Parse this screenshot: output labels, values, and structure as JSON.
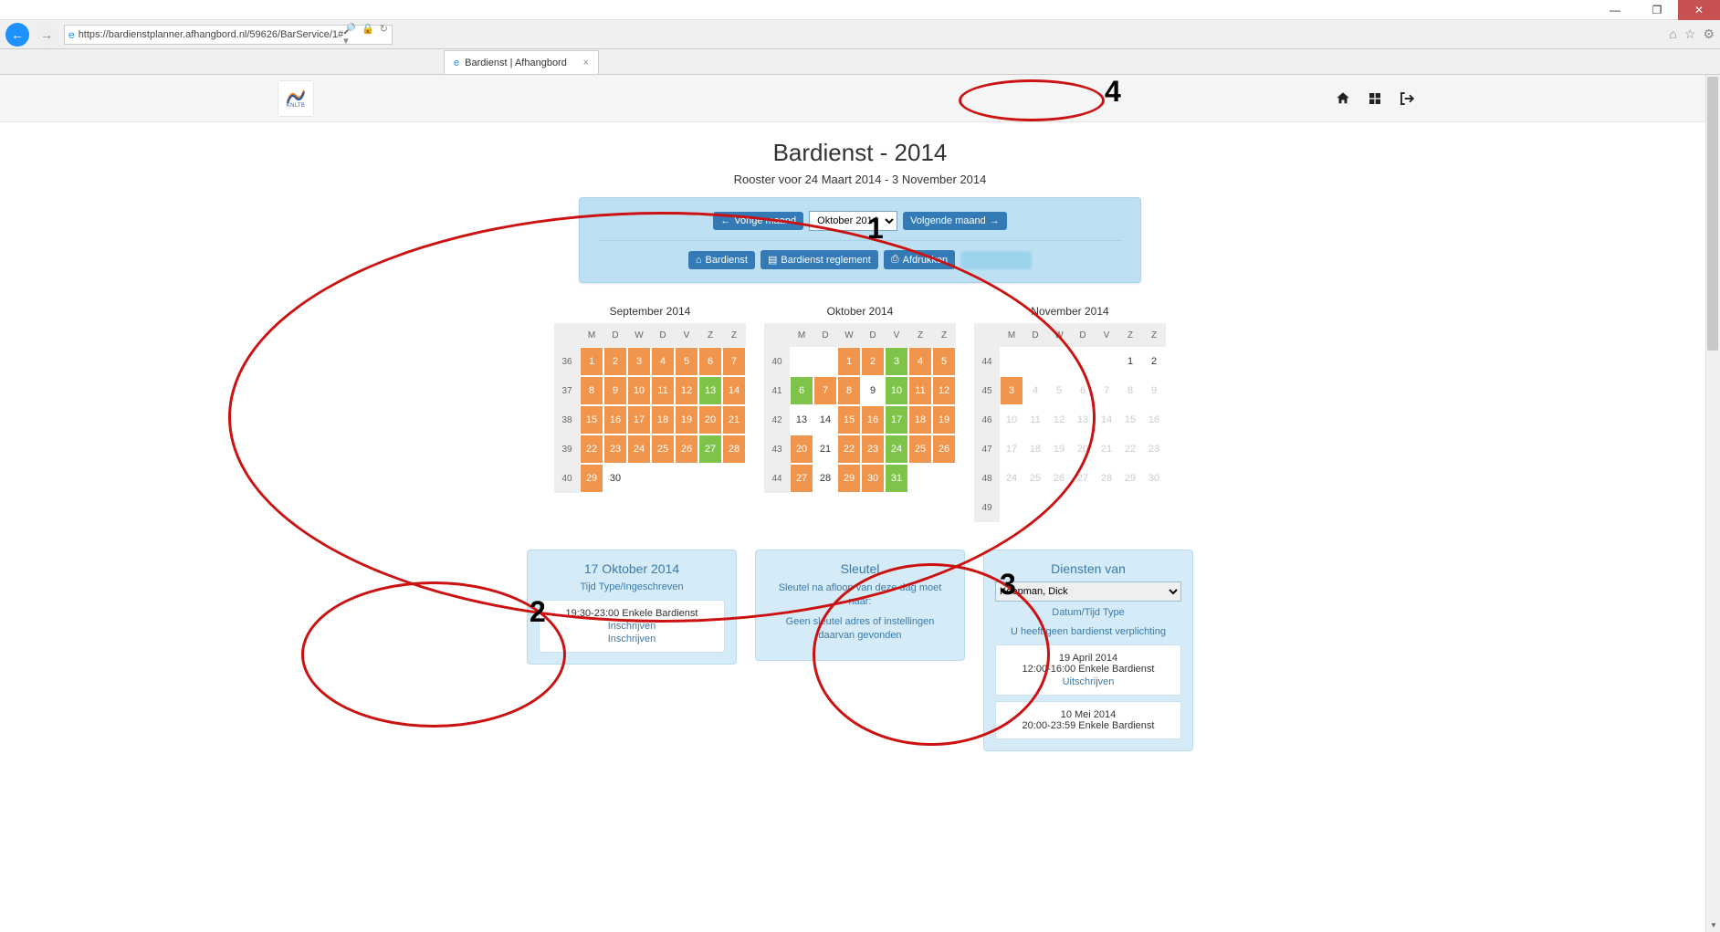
{
  "browser": {
    "url": "https://bardienstplanner.afhangbord.nl/59626/BarService/1#",
    "tab_title": "Bardienst | Afhangbord"
  },
  "header": {
    "logo_text": "KNLTB"
  },
  "page": {
    "title": "Bardienst - 2014",
    "subtitle": "Rooster voor 24 Maart 2014 - 3 November 2014"
  },
  "toolbar": {
    "prev": "Vorige maand",
    "next": "Volgende maand",
    "month_select": "Oktober 2014",
    "bardienst": "Bardienst",
    "reglement": "Bardienst reglement",
    "afdrukken": "Afdrukken"
  },
  "calendars": [
    {
      "title": "September 2014",
      "headers": [
        "M",
        "D",
        "W",
        "D",
        "V",
        "Z",
        "Z"
      ],
      "rows": [
        {
          "wk": "36",
          "days": [
            {
              "n": "1",
              "c": "o"
            },
            {
              "n": "2",
              "c": "o"
            },
            {
              "n": "3",
              "c": "o"
            },
            {
              "n": "4",
              "c": "o"
            },
            {
              "n": "5",
              "c": "o"
            },
            {
              "n": "6",
              "c": "o"
            },
            {
              "n": "7",
              "c": "o"
            }
          ]
        },
        {
          "wk": "37",
          "days": [
            {
              "n": "8",
              "c": "o"
            },
            {
              "n": "9",
              "c": "o"
            },
            {
              "n": "10",
              "c": "o"
            },
            {
              "n": "11",
              "c": "o"
            },
            {
              "n": "12",
              "c": "o"
            },
            {
              "n": "13",
              "c": "g"
            },
            {
              "n": "14",
              "c": "o"
            }
          ]
        },
        {
          "wk": "38",
          "days": [
            {
              "n": "15",
              "c": "o"
            },
            {
              "n": "16",
              "c": "o"
            },
            {
              "n": "17",
              "c": "o"
            },
            {
              "n": "18",
              "c": "o"
            },
            {
              "n": "19",
              "c": "o"
            },
            {
              "n": "20",
              "c": "o"
            },
            {
              "n": "21",
              "c": "o"
            }
          ]
        },
        {
          "wk": "39",
          "days": [
            {
              "n": "22",
              "c": "o"
            },
            {
              "n": "23",
              "c": "o"
            },
            {
              "n": "24",
              "c": "o"
            },
            {
              "n": "25",
              "c": "o"
            },
            {
              "n": "26",
              "c": "o"
            },
            {
              "n": "27",
              "c": "g"
            },
            {
              "n": "28",
              "c": "o"
            }
          ]
        },
        {
          "wk": "40",
          "days": [
            {
              "n": "29",
              "c": "o"
            },
            {
              "n": "30",
              "c": "p"
            },
            {
              "n": "",
              "c": "e"
            },
            {
              "n": "",
              "c": "e"
            },
            {
              "n": "",
              "c": "e"
            },
            {
              "n": "",
              "c": "e"
            },
            {
              "n": "",
              "c": "e"
            }
          ]
        }
      ]
    },
    {
      "title": "Oktober 2014",
      "headers": [
        "M",
        "D",
        "W",
        "D",
        "V",
        "Z",
        "Z"
      ],
      "rows": [
        {
          "wk": "40",
          "days": [
            {
              "n": "",
              "c": "e"
            },
            {
              "n": "",
              "c": "e"
            },
            {
              "n": "1",
              "c": "o"
            },
            {
              "n": "2",
              "c": "o"
            },
            {
              "n": "3",
              "c": "g"
            },
            {
              "n": "4",
              "c": "o"
            },
            {
              "n": "5",
              "c": "o"
            }
          ]
        },
        {
          "wk": "41",
          "days": [
            {
              "n": "6",
              "c": "g"
            },
            {
              "n": "7",
              "c": "o"
            },
            {
              "n": "8",
              "c": "o"
            },
            {
              "n": "9",
              "c": "p"
            },
            {
              "n": "10",
              "c": "g"
            },
            {
              "n": "11",
              "c": "o"
            },
            {
              "n": "12",
              "c": "o"
            }
          ]
        },
        {
          "wk": "42",
          "days": [
            {
              "n": "13",
              "c": "p"
            },
            {
              "n": "14",
              "c": "p"
            },
            {
              "n": "15",
              "c": "o"
            },
            {
              "n": "16",
              "c": "o"
            },
            {
              "n": "17",
              "c": "g"
            },
            {
              "n": "18",
              "c": "o"
            },
            {
              "n": "19",
              "c": "o"
            }
          ]
        },
        {
          "wk": "43",
          "days": [
            {
              "n": "20",
              "c": "o"
            },
            {
              "n": "21",
              "c": "p"
            },
            {
              "n": "22",
              "c": "o"
            },
            {
              "n": "23",
              "c": "o"
            },
            {
              "n": "24",
              "c": "g"
            },
            {
              "n": "25",
              "c": "o"
            },
            {
              "n": "26",
              "c": "o"
            }
          ]
        },
        {
          "wk": "44",
          "days": [
            {
              "n": "27",
              "c": "o"
            },
            {
              "n": "28",
              "c": "p"
            },
            {
              "n": "29",
              "c": "o"
            },
            {
              "n": "30",
              "c": "o"
            },
            {
              "n": "31",
              "c": "g"
            },
            {
              "n": "",
              "c": "e"
            },
            {
              "n": "",
              "c": "e"
            }
          ]
        }
      ]
    },
    {
      "title": "November 2014",
      "headers": [
        "M",
        "D",
        "W",
        "D",
        "V",
        "Z",
        "Z"
      ],
      "rows": [
        {
          "wk": "44",
          "days": [
            {
              "n": "",
              "c": "e"
            },
            {
              "n": "",
              "c": "e"
            },
            {
              "n": "",
              "c": "e"
            },
            {
              "n": "",
              "c": "e"
            },
            {
              "n": "",
              "c": "e"
            },
            {
              "n": "1",
              "c": "p"
            },
            {
              "n": "2",
              "c": "p"
            }
          ]
        },
        {
          "wk": "45",
          "days": [
            {
              "n": "3",
              "c": "o"
            },
            {
              "n": "4",
              "c": "m"
            },
            {
              "n": "5",
              "c": "m"
            },
            {
              "n": "6",
              "c": "m"
            },
            {
              "n": "7",
              "c": "m"
            },
            {
              "n": "8",
              "c": "m"
            },
            {
              "n": "9",
              "c": "m"
            }
          ]
        },
        {
          "wk": "46",
          "days": [
            {
              "n": "10",
              "c": "m"
            },
            {
              "n": "11",
              "c": "m"
            },
            {
              "n": "12",
              "c": "m"
            },
            {
              "n": "13",
              "c": "m"
            },
            {
              "n": "14",
              "c": "m"
            },
            {
              "n": "15",
              "c": "m"
            },
            {
              "n": "16",
              "c": "m"
            }
          ]
        },
        {
          "wk": "47",
          "days": [
            {
              "n": "17",
              "c": "m"
            },
            {
              "n": "18",
              "c": "m"
            },
            {
              "n": "19",
              "c": "m"
            },
            {
              "n": "20",
              "c": "m"
            },
            {
              "n": "21",
              "c": "m"
            },
            {
              "n": "22",
              "c": "m"
            },
            {
              "n": "23",
              "c": "m"
            }
          ]
        },
        {
          "wk": "48",
          "days": [
            {
              "n": "24",
              "c": "m"
            },
            {
              "n": "25",
              "c": "m"
            },
            {
              "n": "26",
              "c": "m"
            },
            {
              "n": "27",
              "c": "m"
            },
            {
              "n": "28",
              "c": "m"
            },
            {
              "n": "29",
              "c": "m"
            },
            {
              "n": "30",
              "c": "m"
            }
          ]
        },
        {
          "wk": "49",
          "days": [
            {
              "n": "",
              "c": "e"
            },
            {
              "n": "",
              "c": "e"
            },
            {
              "n": "",
              "c": "e"
            },
            {
              "n": "",
              "c": "e"
            },
            {
              "n": "",
              "c": "e"
            },
            {
              "n": "",
              "c": "e"
            },
            {
              "n": "",
              "c": "e"
            }
          ]
        }
      ]
    }
  ],
  "panel_day": {
    "title": "17 Oktober 2014",
    "sub": "Tijd Type/Ingeschreven",
    "slot": "19:30-23:00 Enkele Bardienst",
    "link1": "Inschrijven",
    "link2": "Inschrijven"
  },
  "panel_key": {
    "title": "Sleutel",
    "line1": "Sleutel na afloop van deze dag moet naar:",
    "line2": "Geen sleutel adres of instellingen daarvan gevonden"
  },
  "panel_services": {
    "title": "Diensten van",
    "select": "Koopman, Dick",
    "sub": "Datum/Tijd Type",
    "note": "U heeft geen bardienst verplichting",
    "items": [
      {
        "date": "19 April 2014",
        "slot": "12:00-16:00 Enkele Bardienst",
        "link": "Uitschrijven"
      },
      {
        "date": "10 Mei 2014",
        "slot": "20:00-23:59 Enkele Bardienst"
      }
    ]
  },
  "annotations": {
    "n1": "1",
    "n2": "2",
    "n3": "3",
    "n4": "4"
  }
}
